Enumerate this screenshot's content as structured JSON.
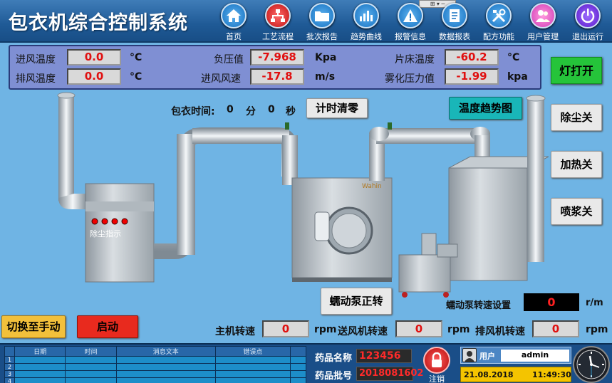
{
  "app": {
    "title": "包衣机综合控制系统"
  },
  "nav": [
    {
      "label": "首页",
      "icon": "home-icon",
      "color": "#1e8fe0"
    },
    {
      "label": "工艺流程",
      "icon": "flow-chart-icon",
      "color": "#e02424"
    },
    {
      "label": "批次报告",
      "icon": "folder-icon",
      "color": "#1e8fe0"
    },
    {
      "label": "趋势曲线",
      "icon": "bar-chart-icon",
      "color": "#1e8fe0"
    },
    {
      "label": "报警信息",
      "icon": "warning-icon",
      "color": "#1e8fe0"
    },
    {
      "label": "数据报表",
      "icon": "report-icon",
      "color": "#1e8fe0"
    },
    {
      "label": "配方功能",
      "icon": "tools-icon",
      "color": "#1e8fe0"
    },
    {
      "label": "用户管理",
      "icon": "users-icon",
      "color": "#1e8fe0"
    },
    {
      "label": "退出运行",
      "icon": "power-icon",
      "color": "#7a2ee0"
    }
  ],
  "sensors": {
    "inlet_temp": {
      "label": "进风温度",
      "value": "0.0",
      "unit": "°C"
    },
    "exhaust_temp": {
      "label": "排风温度",
      "value": "0.0",
      "unit": "°C"
    },
    "neg_pressure": {
      "label": "负压值",
      "value": "-7.968",
      "unit": "Kpa"
    },
    "inlet_speed": {
      "label": "进风风速",
      "value": "-17.8",
      "unit": "m/s"
    },
    "bed_temp": {
      "label": "片床温度",
      "value": "-60.2",
      "unit": "°C"
    },
    "atomize_pressure": {
      "label": "雾化压力值",
      "value": "-1.99",
      "unit": "kpa"
    }
  },
  "timer": {
    "label": "包衣时间:",
    "minutes": "0",
    "min_unit": "分",
    "seconds": "0",
    "sec_unit": "秒",
    "reset_label": "计时清零"
  },
  "buttons": {
    "temp_trend": "温度趋势图",
    "light": "灯打开",
    "dust": "除尘关",
    "heat": "加热关",
    "spray": "喷浆关",
    "pump_forward": "蠕动泵正转",
    "manual": "切换至手动",
    "start": "启动"
  },
  "diagram": {
    "dust_indicator": "除尘指示",
    "brand": "Wahin"
  },
  "pump_speed": {
    "label": "蠕动泵转速设置",
    "value": "0",
    "unit": "r/m"
  },
  "speeds": {
    "main": {
      "label": "主机转速",
      "value": "0",
      "unit": "rpm"
    },
    "supply_fan": {
      "label": "送风机转速",
      "value": "0",
      "unit": "rpm"
    },
    "exhaust_fan": {
      "label": "排风机转速",
      "value": "0",
      "unit": "rpm"
    }
  },
  "log": {
    "headers": [
      "日期",
      "时间",
      "消息文本",
      "错误点"
    ],
    "rows": [
      "1",
      "2",
      "3",
      "4"
    ]
  },
  "product": {
    "name_label": "药品名称",
    "name_value": "123456",
    "batch_label": "药品批号",
    "batch_value": "2018081602"
  },
  "logout": {
    "label": "注销"
  },
  "user": {
    "label": "用户",
    "name": "admin",
    "date": "21.08.2018",
    "time": "11:49:30"
  },
  "colors": {
    "header": "#1f5a96",
    "background": "#6fb4e4",
    "alarm_red": "#e01010",
    "panel": "#7f8fd3"
  }
}
